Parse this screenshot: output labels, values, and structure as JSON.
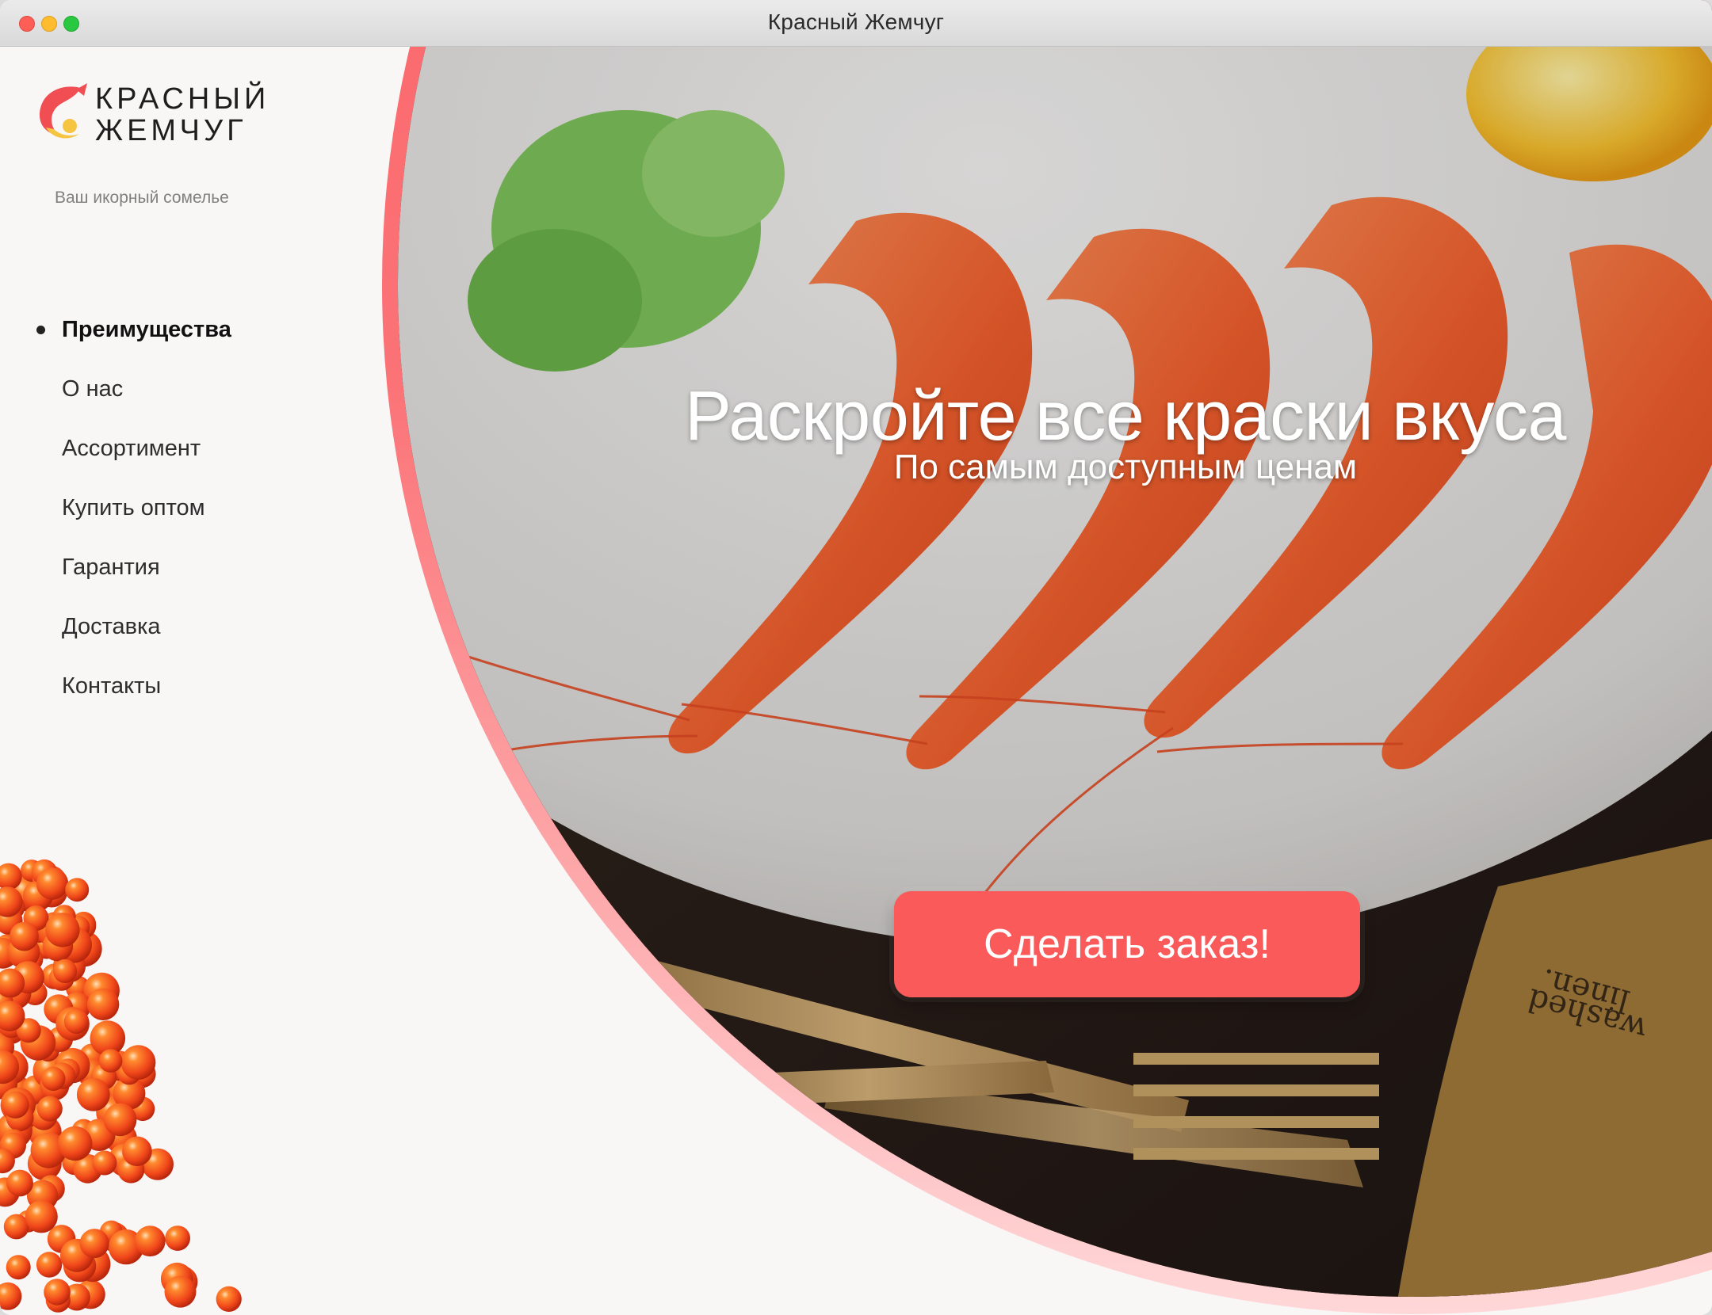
{
  "window": {
    "title": "Красный Жемчуг"
  },
  "brand": {
    "name_line1": "КРАСНЫЙ",
    "name_line2": "ЖЕМЧУГ",
    "tagline": "Ваш икорный сомелье",
    "colors": {
      "accent": "#fb5a5a",
      "logo_red": "#f04e53",
      "logo_yellow": "#f5c542"
    }
  },
  "nav": {
    "items": [
      {
        "label": "Преимущества",
        "active": true
      },
      {
        "label": "О нас",
        "active": false
      },
      {
        "label": "Ассортимент",
        "active": false
      },
      {
        "label": "Купить оптом",
        "active": false
      },
      {
        "label": "Гарантия",
        "active": false
      },
      {
        "label": "Доставка",
        "active": false
      },
      {
        "label": "Контакты",
        "active": false
      }
    ]
  },
  "hero": {
    "title": "Раскройте все краски вкуса",
    "subtitle": "По самым доступным ценам",
    "cta_label": "Сделать заказ!",
    "napkin_text_line1": "washed",
    "napkin_text_line2": "linen."
  }
}
